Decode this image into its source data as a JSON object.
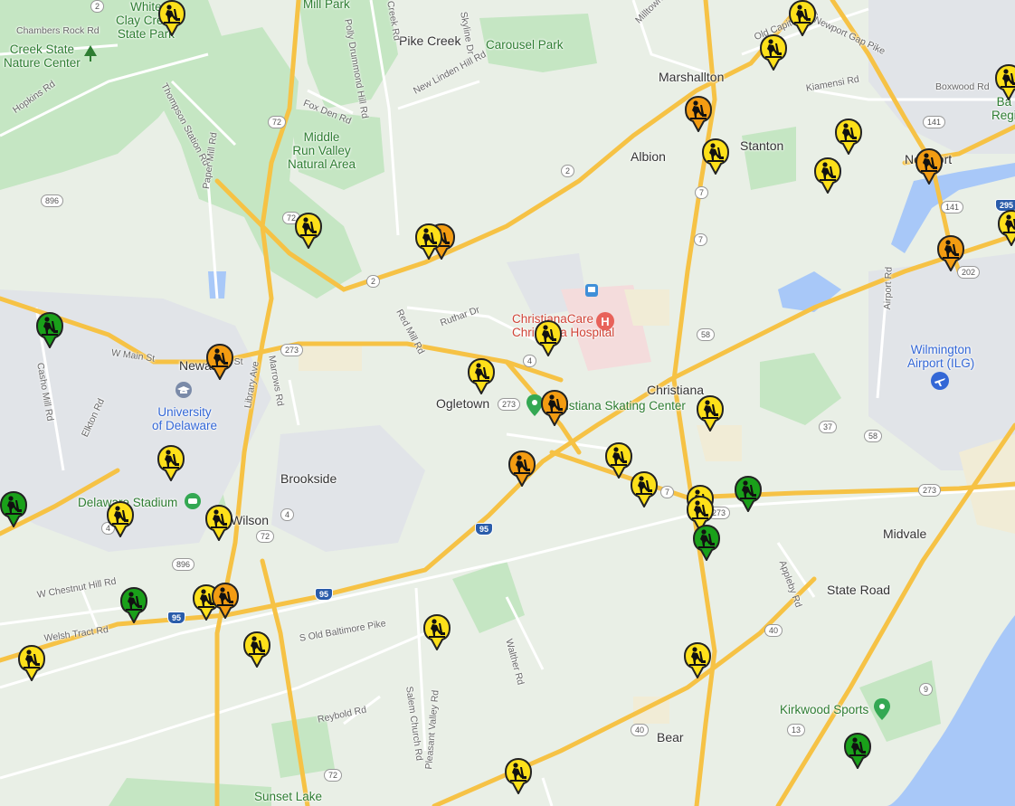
{
  "colors": {
    "land": "#e9efe6",
    "park": "#c5e6c3",
    "urban": "#e3e6ea",
    "water": "#a8c8f8",
    "highway": "#f6c245",
    "road": "#ffffff",
    "marker_yellow": "#fde01a",
    "marker_orange": "#f39c12",
    "marker_green": "#1aa01a"
  },
  "places": [
    {
      "id": "white-clay",
      "text": "White\nClay Creek\nState Park",
      "kind": "park"
    },
    {
      "id": "mill-park",
      "text": "Mill Park",
      "kind": "park"
    },
    {
      "id": "pike-creek",
      "text": "Pike Creek",
      "kind": "town"
    },
    {
      "id": "carousel-park",
      "text": "Carousel Park",
      "kind": "park"
    },
    {
      "id": "creek-nature",
      "text": "Creek State\nNature Center",
      "kind": "park"
    },
    {
      "id": "marshallton",
      "text": "Marshallton",
      "kind": "town"
    },
    {
      "id": "middle-run",
      "text": "Middle\nRun Valley\nNatural Area",
      "kind": "park"
    },
    {
      "id": "albion",
      "text": "Albion",
      "kind": "town"
    },
    {
      "id": "stanton",
      "text": "Stanton",
      "kind": "town"
    },
    {
      "id": "newport",
      "text": "Newport",
      "kind": "town"
    },
    {
      "id": "christiana-hospital",
      "text": "ChristianaCare\nChristiana Hospital",
      "kind": "poi-red"
    },
    {
      "id": "newark",
      "text": "Newark",
      "kind": "town"
    },
    {
      "id": "ogletown",
      "text": "Ogletown",
      "kind": "town"
    },
    {
      "id": "christiana",
      "text": "Christiana",
      "kind": "town"
    },
    {
      "id": "skating",
      "text": "Christiana Skating Center",
      "kind": "park"
    },
    {
      "id": "wilmington-airport",
      "text": "Wilmington\nAirport (ILG)",
      "kind": "poi-blue"
    },
    {
      "id": "udel",
      "text": "University\nof Delaware",
      "kind": "poi-blue"
    },
    {
      "id": "brookside",
      "text": "Brookside",
      "kind": "town"
    },
    {
      "id": "delaware-stadium",
      "text": "Delaware Stadium",
      "kind": "park"
    },
    {
      "id": "wilson",
      "text": "Wilson",
      "kind": "town"
    },
    {
      "id": "midvale",
      "text": "Midvale",
      "kind": "town"
    },
    {
      "id": "state-road",
      "text": "State Road",
      "kind": "town"
    },
    {
      "id": "kirkwood",
      "text": "Kirkwood Sports",
      "kind": "park"
    },
    {
      "id": "bear",
      "text": "Bear",
      "kind": "town"
    },
    {
      "id": "sunset-lake",
      "text": "Sunset Lake",
      "kind": "park"
    },
    {
      "id": "regional",
      "text": "Ba\nRegi",
      "kind": "park"
    }
  ],
  "road_labels": [
    "Chambers Rock Rd",
    "Hopkins Rd",
    "Thompson Station Rd",
    "Fox Den Rd",
    "Polly Drummond Hill Rd",
    "Creek Rd",
    "Skyline Dr",
    "New Linden Hill Rd",
    "Milltown Rd",
    "Old Capitol Trail",
    "Newport Gap Pike",
    "Kiamensi Rd",
    "Boxwood Rd",
    "Paper Mill Rd",
    "Red Mill Rd",
    "Ruthar Dr",
    "Casho Mill Rd",
    "W Main St",
    "Elkton Rd",
    "Library Ave",
    "Marrows Rd",
    "Airport Rd",
    "W Chestnut Hill Rd",
    "Welsh Tract Rd",
    "S Old Baltimore Pike",
    "Reybold Rd",
    "Salem Church Rd",
    "Walther Rd",
    "Appleby Rd",
    "Pleasant Valley Rd",
    "Main St"
  ],
  "shields": [
    "2",
    "2",
    "2",
    "72",
    "72",
    "72",
    "72",
    "4",
    "4",
    "4",
    "7",
    "7",
    "7",
    "58",
    "58",
    "141",
    "141",
    "273",
    "273",
    "273",
    "273",
    "37",
    "40",
    "40",
    "13",
    "9",
    "896",
    "896",
    "95",
    "95",
    "95",
    "295",
    "202"
  ],
  "markers": [
    {
      "id": "m1",
      "status": "yellow"
    },
    {
      "id": "m2",
      "status": "yellow"
    },
    {
      "id": "m3",
      "status": "yellow"
    },
    {
      "id": "m4",
      "status": "orange"
    },
    {
      "id": "m5",
      "status": "yellow"
    },
    {
      "id": "m6",
      "status": "orange"
    },
    {
      "id": "m7",
      "status": "yellow"
    },
    {
      "id": "m8",
      "status": "yellow"
    },
    {
      "id": "m9",
      "status": "yellow"
    },
    {
      "id": "m10",
      "status": "yellow"
    },
    {
      "id": "m11",
      "status": "orange"
    },
    {
      "id": "m12",
      "status": "orange"
    },
    {
      "id": "m13",
      "status": "yellow"
    },
    {
      "id": "m14",
      "status": "green"
    },
    {
      "id": "m15",
      "status": "orange"
    },
    {
      "id": "m16",
      "status": "yellow"
    },
    {
      "id": "m17",
      "status": "yellow"
    },
    {
      "id": "m18",
      "status": "orange"
    },
    {
      "id": "m19",
      "status": "yellow"
    },
    {
      "id": "m20",
      "status": "orange"
    },
    {
      "id": "m21",
      "status": "yellow"
    },
    {
      "id": "m22",
      "status": "yellow"
    },
    {
      "id": "m23",
      "status": "green"
    },
    {
      "id": "m24",
      "status": "yellow"
    },
    {
      "id": "m25",
      "status": "yellow"
    },
    {
      "id": "m26",
      "status": "yellow"
    },
    {
      "id": "m27",
      "status": "green"
    },
    {
      "id": "m28",
      "status": "green"
    },
    {
      "id": "m29",
      "status": "yellow"
    },
    {
      "id": "m30",
      "status": "yellow"
    },
    {
      "id": "m31",
      "status": "green"
    },
    {
      "id": "m32",
      "status": "yellow"
    },
    {
      "id": "m33",
      "status": "orange"
    },
    {
      "id": "m34",
      "status": "yellow"
    },
    {
      "id": "m35",
      "status": "yellow"
    },
    {
      "id": "m36",
      "status": "yellow"
    },
    {
      "id": "m37",
      "status": "yellow"
    },
    {
      "id": "m38",
      "status": "green"
    },
    {
      "id": "m39",
      "status": "yellow"
    },
    {
      "id": "m40",
      "status": "yellow"
    },
    {
      "id": "m41",
      "status": "yellow"
    }
  ],
  "icons": {
    "marker_glyph": "worker-digging-icon",
    "hospital": "hospital-icon",
    "airport": "airplane-icon",
    "place_pin": "green-place-pin-icon",
    "university": "graduation-cap-icon",
    "bus": "bus-station-icon",
    "tree": "tree-icon"
  }
}
